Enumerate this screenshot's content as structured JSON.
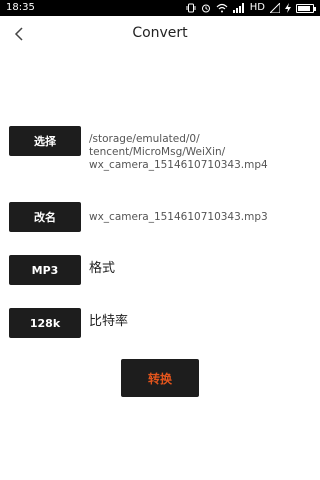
{
  "status_bar": {
    "time": "18:35",
    "network": "HD"
  },
  "header": {
    "title": "Convert"
  },
  "select_row": {
    "button_label": "选择",
    "path": "/storage/emulated/0/\ntencent/MicroMsg/WeiXin/\nwx_camera_1514610710343.mp4"
  },
  "rename_row": {
    "button_label": "改名",
    "filename": "wx_camera_1514610710343.mp3"
  },
  "format_row": {
    "button_label": "MP3",
    "label": "格式"
  },
  "bitrate_row": {
    "button_label": "128k",
    "label": "比特率"
  },
  "convert_button": {
    "label": "转换"
  },
  "colors": {
    "button_bg": "#1d1d1d",
    "convert_text": "#e2541c",
    "status_bar": "#000000"
  }
}
